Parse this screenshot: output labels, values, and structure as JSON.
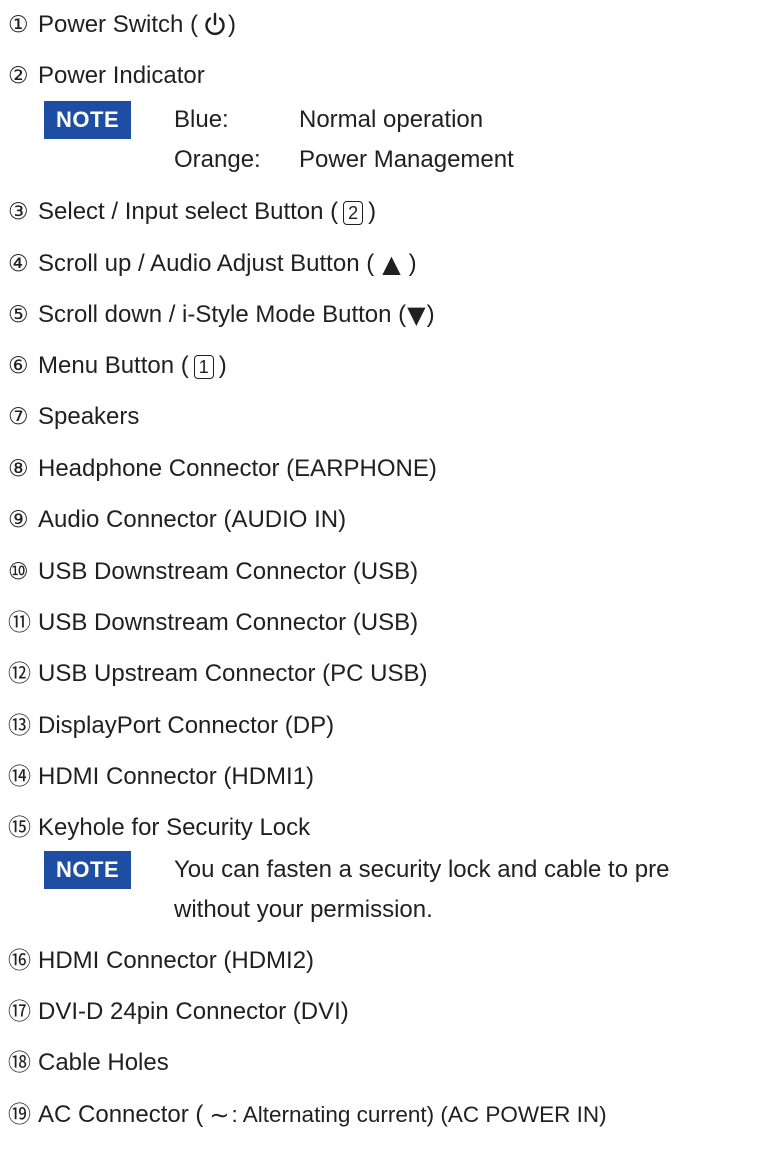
{
  "items": [
    {
      "num": "①",
      "label_pre": "Power Switch (",
      "label_post": ")"
    },
    {
      "num": "②",
      "label": "Power Indicator"
    },
    {
      "num": "③",
      "label_pre": "Select / Input select Button (",
      "key": "2",
      "label_post": ")"
    },
    {
      "num": "④",
      "label_pre": "Scroll up / Audio Adjust Button (",
      "symbol": "▲",
      "label_post": ")"
    },
    {
      "num": "⑤",
      "label_pre": "Scroll down / i-Style Mode Button (",
      "symbol": "▼",
      "label_post": ")"
    },
    {
      "num": "⑥",
      "label_pre": "Menu Button (",
      "key": "1",
      "label_post": ")"
    },
    {
      "num": "⑦",
      "label": "Speakers"
    },
    {
      "num": "⑧",
      "label": "Headphone Connector (EARPHONE)"
    },
    {
      "num": "⑨",
      "label": "Audio Connector (AUDIO IN)"
    },
    {
      "num": "⑩",
      "label": "USB Downstream Connector (USB)"
    },
    {
      "num": "⑪",
      "label": "USB Downstream Connector (USB)"
    },
    {
      "num": "⑫",
      "label": "USB Upstream Connector (PC USB)"
    },
    {
      "num": "⑬",
      "label": "DisplayPort Connector (DP)"
    },
    {
      "num": "⑭",
      "label": "HDMI Connector (HDMI1)"
    },
    {
      "num": "⑮",
      "label": "Keyhole for Security Lock"
    },
    {
      "num": "⑯",
      "label": "HDMI Connector (HDMI2)"
    },
    {
      "num": "⑰",
      "label": "DVI-D 24pin Connector (DVI)"
    },
    {
      "num": "⑱",
      "label": "Cable Holes"
    },
    {
      "num": "⑲",
      "label_pre": "AC Connector (",
      "symbol": "∼",
      "label_post": ": Alternating current) (AC POWER IN)"
    }
  ],
  "notes": {
    "badge": "NOTE",
    "indicator": [
      {
        "term": "Blue:",
        "desc": "Normal operation"
      },
      {
        "term": "Orange:",
        "desc": "Power Management"
      }
    ],
    "security_line1": "You can fasten a security lock and cable to pre",
    "security_line2": "without your permission."
  },
  "icons": {
    "power": "power-symbol-icon"
  },
  "colors": {
    "note_badge": "#1e4ea3",
    "text": "#231f20"
  }
}
